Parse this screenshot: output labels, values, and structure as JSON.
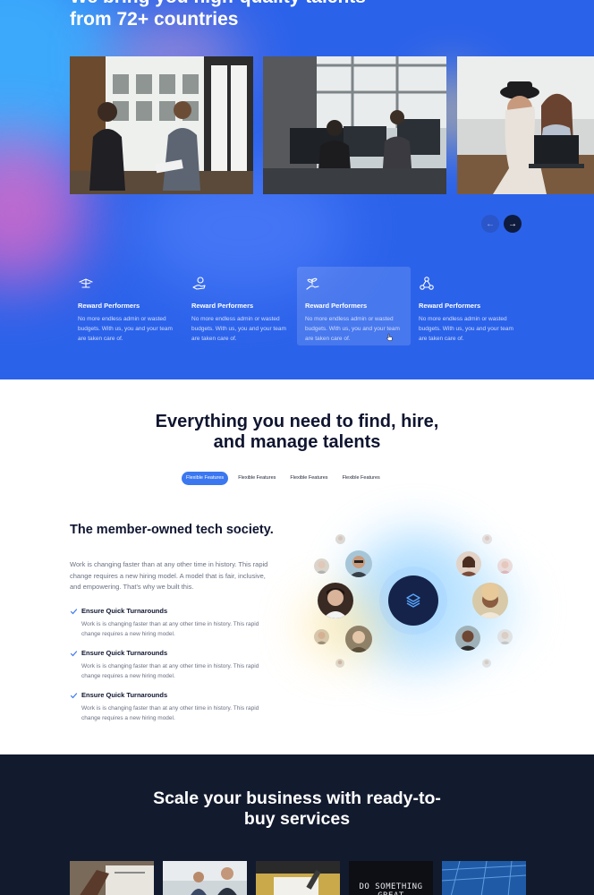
{
  "hero": {
    "title_line1": "We bring you high-quality talents",
    "title_line2": "from 72+ countries",
    "carousel": {
      "prev_icon": "arrow-left-icon",
      "next_icon": "arrow-right-icon",
      "prev_label": "←",
      "next_label": "→"
    },
    "features": [
      {
        "icon": "hand-holding-icon",
        "title": "Reward Performers",
        "text": "No more endless admin or wasted budgets. With us, you and your team are taken care of."
      },
      {
        "icon": "coin-hand-icon",
        "title": "Reward Performers",
        "text": "No more endless admin or wasted budgets. With us, you and your team are taken care of."
      },
      {
        "icon": "plant-hand-icon",
        "title": "Reward Performers",
        "text": "No more endless admin or wasted budgets. With us, you and your team are taken care of."
      },
      {
        "icon": "network-nodes-icon",
        "title": "Reward Performers",
        "text": "No more endless admin or wasted budgets. With us, you and your team are taken care of."
      }
    ]
  },
  "features_section": {
    "title_line1": "Everything you need to find, hire,",
    "title_line2": "and manage talents",
    "tabs": [
      {
        "label": "Flexible Features",
        "active": true
      },
      {
        "label": "Flexible Features",
        "active": false
      },
      {
        "label": "Flexible Features",
        "active": false
      },
      {
        "label": "Flexible Features",
        "active": false
      }
    ]
  },
  "member": {
    "title": "The member-owned tech society.",
    "description": "Work is changing faster than at any other time in history. This rapid change requires a new hiring model. A model that is fair, inclusive, and empowering. That's why we built this.",
    "checks": [
      {
        "title": "Ensure Quick Turnarounds",
        "text": "Work is is changing faster than at any other time in history. This rapid change requires a new hiring model."
      },
      {
        "title": "Ensure Quick Turnarounds",
        "text": "Work is is changing faster than at any other time in history. This rapid change requires a new hiring model."
      },
      {
        "title": "Ensure Quick Turnarounds",
        "text": "Work is is changing faster than at any other time in history. This rapid change requires a new hiring model."
      }
    ],
    "hub_icon": "layers-stack-icon"
  },
  "services": {
    "title_line1": "Scale your business with  ready-to-",
    "title_line2": "buy services",
    "thumb_caption": "DO SOMETHING GREAT"
  },
  "colors": {
    "hero_blue": "#2b62ea",
    "accent": "#3b78f0",
    "dark_bg": "#121a2e",
    "heading": "#0f1530"
  }
}
